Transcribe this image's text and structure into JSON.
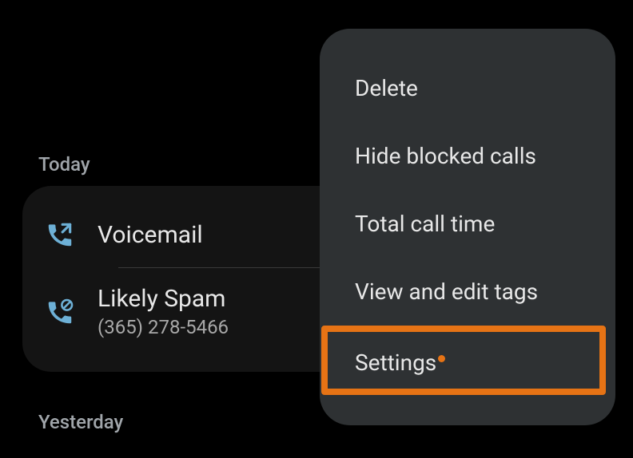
{
  "sections": {
    "today": "Today",
    "yesterday": "Yesterday"
  },
  "calls": [
    {
      "title": "Voicemail",
      "subtitle": "",
      "icon": "phone-outgoing"
    },
    {
      "title": "Likely Spam",
      "subtitle": "(365) 278-5466",
      "icon": "phone-blocked"
    }
  ],
  "menu": {
    "items": [
      {
        "label": "Delete",
        "highlighted": false,
        "badge": false
      },
      {
        "label": "Hide blocked calls",
        "highlighted": false,
        "badge": false
      },
      {
        "label": "Total call time",
        "highlighted": false,
        "badge": false
      },
      {
        "label": "View and edit tags",
        "highlighted": false,
        "badge": false
      },
      {
        "label": "Settings",
        "highlighted": true,
        "badge": true
      }
    ]
  }
}
